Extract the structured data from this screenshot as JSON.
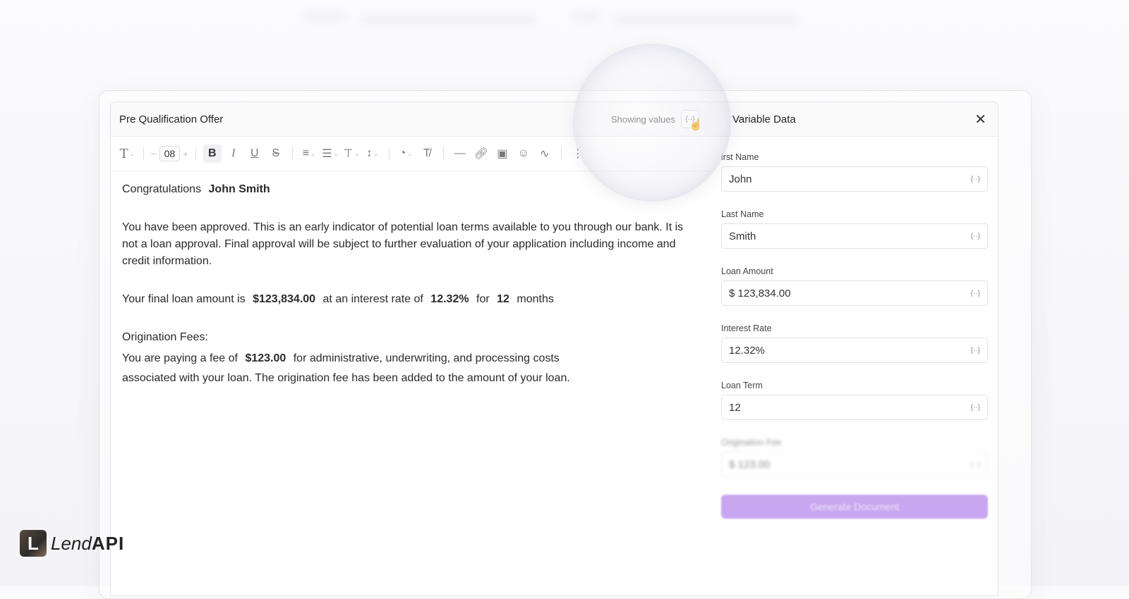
{
  "editor": {
    "title": "Pre Qualification Offer",
    "showing_values": "Showing values",
    "var_icon": "{··}",
    "toolbar": {
      "font_size": "08",
      "icons": [
        "text-type-icon",
        "bold-icon",
        "italic-icon",
        "underline-icon",
        "strikethrough-icon",
        "align-icon",
        "list-icon",
        "text-height-icon",
        "line-height-icon",
        "palette-icon",
        "clear-format-icon",
        "horizontal-rule-icon",
        "link-icon",
        "image-icon",
        "more-icon"
      ]
    },
    "doc": {
      "congrats": "Congratulations",
      "name": "John Smith",
      "para1": "You have been approved. This is an early indicator of potential loan terms available to you through our bank. It is not a loan approval. Final approval will be subject to further evaluation of your application including income and credit information.",
      "line2_a": "Your final loan amount is",
      "line2_amount": "$123,834.00",
      "line2_b": "at an interest rate of",
      "line2_rate": "12.32%",
      "line2_c": "for",
      "line2_term": "12",
      "line2_d": "months",
      "fees_heading": "Origination Fees:",
      "fees_a": "You are paying a fee of",
      "fees_amount": "$123.00",
      "fees_b": "for administrative, underwriting, and processing costs",
      "fees_c": "associated with your loan. The origination fee has been added to the amount of your loan."
    }
  },
  "panel": {
    "title": "Variable Data",
    "fields": [
      {
        "label": "irst Name",
        "value": "John"
      },
      {
        "label": "Last Name",
        "value": "Smith"
      },
      {
        "label": "Loan Amount",
        "value": "$ 123,834.00"
      },
      {
        "label": "Interest Rate",
        "value": "12.32%"
      },
      {
        "label": "Loan Term",
        "value": "12"
      },
      {
        "label": "Origination Fee",
        "value": "$ 123.00"
      }
    ],
    "generate_label": "Generate Document"
  },
  "logo": {
    "lend": "Lend",
    "api": "API",
    "letter": "L"
  },
  "colors": {
    "accent": "#c9a7f0"
  }
}
